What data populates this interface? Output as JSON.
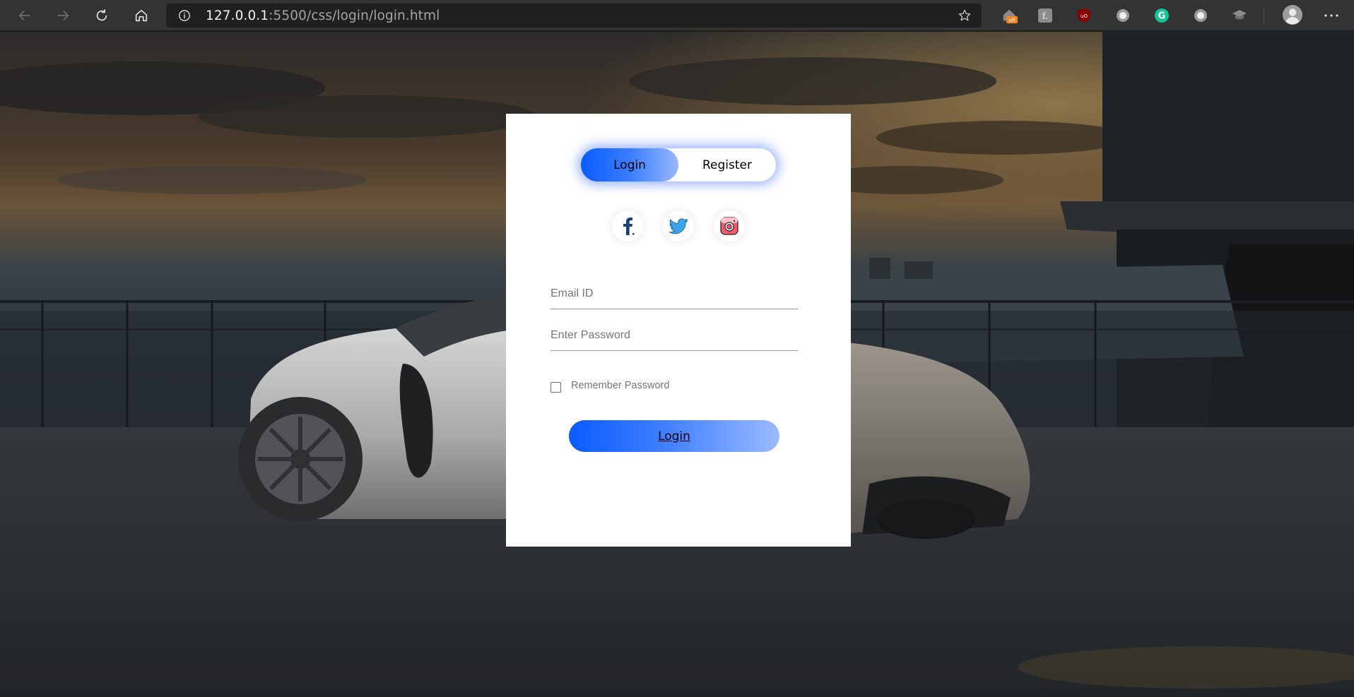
{
  "browser": {
    "url_host": "127.0.0.1",
    "url_path": ":5500/css/login/login.html",
    "icons": {
      "back": "arrow-left-icon",
      "forward": "arrow-right-icon",
      "reload": "reload-icon",
      "home": "home-icon",
      "info": "info-icon",
      "favorite": "star-icon",
      "profile": "avatar-icon",
      "menu": "more-icon"
    },
    "extensions": [
      {
        "name": "honey-extension-icon",
        "badge": "off"
      },
      {
        "name": "font-extension-icon"
      },
      {
        "name": "ublock-extension-icon"
      },
      {
        "name": "circle-extension-icon"
      },
      {
        "name": "grammarly-extension-icon"
      },
      {
        "name": "circle-extension-icon-2"
      },
      {
        "name": "graduation-cap-extension-icon"
      }
    ]
  },
  "login_card": {
    "tabs": {
      "login": "Login",
      "register": "Register",
      "active": "login"
    },
    "social": [
      "facebook-icon",
      "twitter-icon",
      "instagram-icon"
    ],
    "email_placeholder": "Email ID",
    "password_placeholder": "Enter Password",
    "remember_label": "Remember Password",
    "remember_checked": false,
    "submit_label": "Login"
  },
  "colors": {
    "accent_start": "#0a5bff",
    "accent_end": "#9bbaff",
    "toolbar": "#333333",
    "urlbar": "#202020"
  }
}
